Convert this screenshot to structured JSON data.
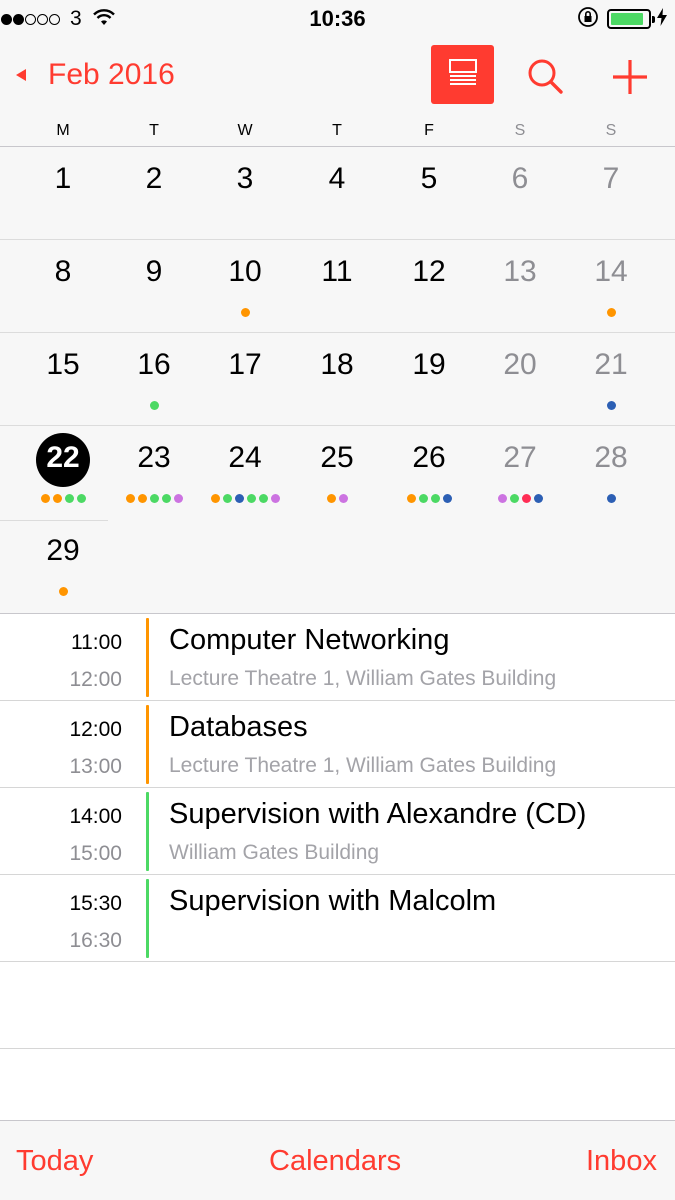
{
  "status_bar": {
    "signal_dots_filled": 2,
    "signal_dots_total": 5,
    "carrier": "3",
    "time": "10:36",
    "battery_level": 0.9,
    "icons": [
      "wifi-icon",
      "orientation-lock-icon",
      "battery-icon",
      "charging-bolt-icon"
    ]
  },
  "nav": {
    "back_label": "Feb 2016",
    "buttons": [
      "list-view-icon",
      "search-icon",
      "add-icon"
    ]
  },
  "weekdays": [
    "M",
    "T",
    "W",
    "T",
    "F",
    "S",
    "S"
  ],
  "colors": {
    "accent": "#ff3b30",
    "orange": "#ff9500",
    "green": "#4cd964",
    "blue": "#2c5fb4",
    "purple": "#cc73e1",
    "pink": "#ff2d55",
    "weekend_gray": "#8e8e93"
  },
  "month": {
    "today": 22,
    "weeks": [
      [
        {
          "day": "1",
          "dots": []
        },
        {
          "day": "2",
          "dots": []
        },
        {
          "day": "3",
          "dots": []
        },
        {
          "day": "4",
          "dots": []
        },
        {
          "day": "5",
          "dots": []
        },
        {
          "day": "6",
          "dots": []
        },
        {
          "day": "7",
          "dots": []
        }
      ],
      [
        {
          "day": "8",
          "dots": []
        },
        {
          "day": "9",
          "dots": []
        },
        {
          "day": "10",
          "dots": [
            "#ff9500"
          ]
        },
        {
          "day": "11",
          "dots": []
        },
        {
          "day": "12",
          "dots": []
        },
        {
          "day": "13",
          "dots": []
        },
        {
          "day": "14",
          "dots": [
            "#ff9500"
          ]
        }
      ],
      [
        {
          "day": "15",
          "dots": []
        },
        {
          "day": "16",
          "dots": [
            "#4cd964"
          ]
        },
        {
          "day": "17",
          "dots": []
        },
        {
          "day": "18",
          "dots": []
        },
        {
          "day": "19",
          "dots": []
        },
        {
          "day": "20",
          "dots": []
        },
        {
          "day": "21",
          "dots": [
            "#2c5fb4"
          ]
        }
      ],
      [
        {
          "day": "22",
          "dots": [
            "#ff9500",
            "#ff9500",
            "#4cd964",
            "#4cd964"
          ]
        },
        {
          "day": "23",
          "dots": [
            "#ff9500",
            "#ff9500",
            "#4cd964",
            "#4cd964",
            "#cc73e1"
          ]
        },
        {
          "day": "24",
          "dots": [
            "#ff9500",
            "#4cd964",
            "#2c5fb4",
            "#4cd964",
            "#4cd964",
            "#cc73e1"
          ]
        },
        {
          "day": "25",
          "dots": [
            "#ff9500",
            "#cc73e1"
          ]
        },
        {
          "day": "26",
          "dots": [
            "#ff9500",
            "#4cd964",
            "#4cd964",
            "#2c5fb4"
          ]
        },
        {
          "day": "27",
          "dots": [
            "#cc73e1",
            "#4cd964",
            "#ff2d55",
            "#2c5fb4"
          ]
        },
        {
          "day": "28",
          "dots": [
            "#2c5fb4"
          ]
        }
      ],
      [
        {
          "day": "29",
          "dots": [
            "#ff9500"
          ]
        }
      ]
    ]
  },
  "events": [
    {
      "start": "11:00",
      "end": "12:00",
      "title": "Computer Networking",
      "location": "Lecture Theatre 1, William Gates Building",
      "color": "#ff9500"
    },
    {
      "start": "12:00",
      "end": "13:00",
      "title": "Databases",
      "location": "Lecture Theatre 1, William Gates Building",
      "color": "#ff9500"
    },
    {
      "start": "14:00",
      "end": "15:00",
      "title": "Supervision with Alexandre (CD)",
      "location": "William Gates Building",
      "color": "#4cd964"
    },
    {
      "start": "15:30",
      "end": "16:30",
      "title": "Supervision with Malcolm",
      "location": "",
      "color": "#4cd964"
    }
  ],
  "tabs": {
    "today": "Today",
    "calendars": "Calendars",
    "inbox": "Inbox"
  }
}
